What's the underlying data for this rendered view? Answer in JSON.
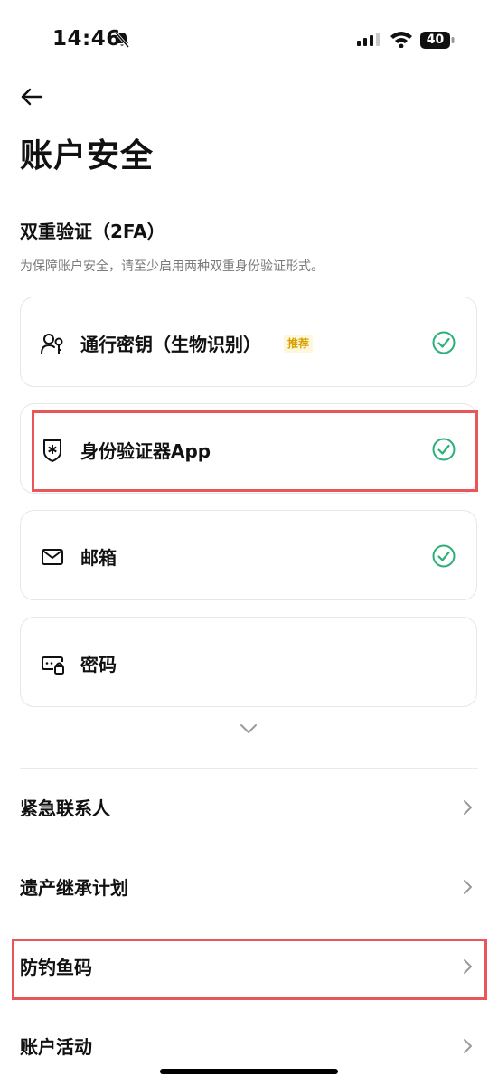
{
  "status_bar": {
    "time": "14:46",
    "battery": "40"
  },
  "header": {
    "title": "账户安全"
  },
  "twofa": {
    "title": "双重验证（2FA）",
    "description": "为保障账户安全，请至少启用两种双重身份验证形式。",
    "items": [
      {
        "label": "通行密钥（生物识别）",
        "badge": "推荐",
        "icon": "passkey-person-icon",
        "enabled": true
      },
      {
        "label": "身份验证器App",
        "icon": "authenticator-shield-icon",
        "enabled": true
      },
      {
        "label": "邮箱",
        "icon": "envelope-icon",
        "enabled": true
      },
      {
        "label": "密码",
        "icon": "password-lock-icon",
        "enabled": false
      }
    ]
  },
  "list": {
    "items": [
      {
        "label": "紧急联系人"
      },
      {
        "label": "遗产继承计划"
      },
      {
        "label": "防钓鱼码"
      },
      {
        "label": "账户活动"
      }
    ]
  },
  "colors": {
    "accent_check": "#2bb07a",
    "highlight": "#e8565a",
    "badge_text": "#d6a000",
    "badge_bg": "#fff7d9"
  }
}
